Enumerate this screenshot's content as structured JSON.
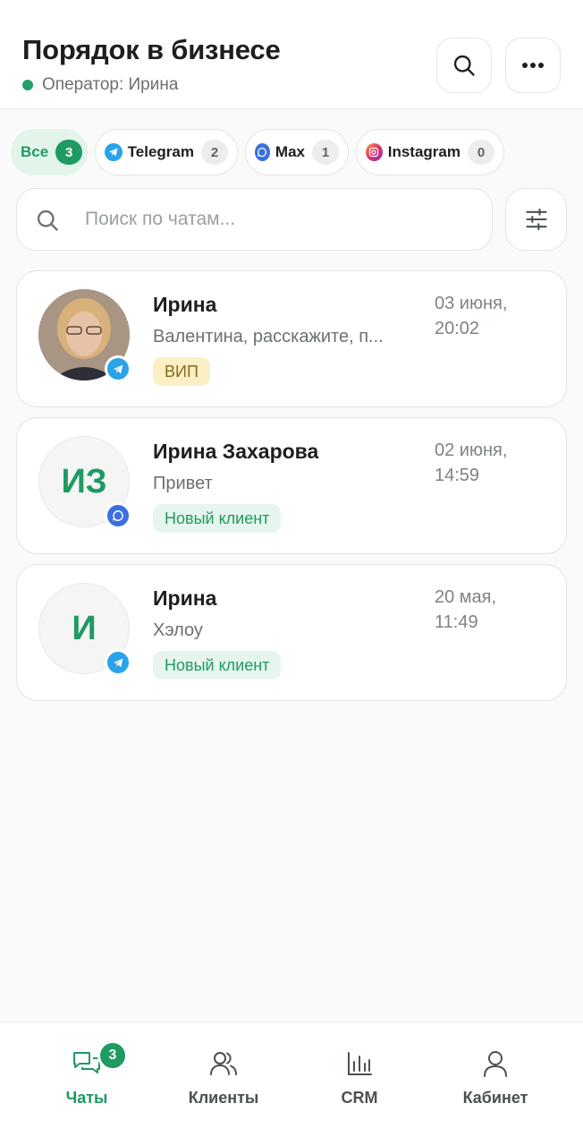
{
  "header": {
    "title": "Порядок в бизнесе",
    "operator": "Оператор: Ирина"
  },
  "filters": [
    {
      "label": "Все",
      "count": "3",
      "active": true
    },
    {
      "label": "Telegram",
      "count": "2",
      "icon": "telegram-icon"
    },
    {
      "label": "Max",
      "count": "1",
      "icon": "max-icon"
    },
    {
      "label": "Instagram",
      "count": "0",
      "icon": "instagram-icon"
    }
  ],
  "search": {
    "placeholder": "Поиск по чатам...",
    "value": ""
  },
  "chats": [
    {
      "name": "Ирина",
      "preview": "Валентина, расскажите, п...",
      "time": "03 июня, 20:02",
      "tag": "ВИП",
      "avatar": "photo",
      "channel": "telegram-icon"
    },
    {
      "name": "Ирина Захарова",
      "preview": "Привет",
      "time": "02 июня, 14:59",
      "tag": "Новый клиент",
      "avatar_initials": "ИЗ",
      "channel": "max-icon"
    },
    {
      "name": "Ирина",
      "preview": "Хэлоу",
      "time": "20 мая, 11:49",
      "tag": "Новый клиент",
      "avatar_initials": "И",
      "channel": "telegram-icon"
    }
  ],
  "nav": {
    "items": [
      {
        "label": "Чаты",
        "icon": "chats-icon",
        "badge": "3",
        "active": true
      },
      {
        "label": "Клиенты",
        "icon": "clients-icon"
      },
      {
        "label": "CRM",
        "icon": "crm-chart-icon"
      },
      {
        "label": "Кабинет",
        "icon": "profile-icon"
      }
    ]
  },
  "colors": {
    "accent": "#1f9a63",
    "telegram": "#2aa3e8",
    "max": "#3b6fe0",
    "vip_bg": "#fbefc6"
  }
}
